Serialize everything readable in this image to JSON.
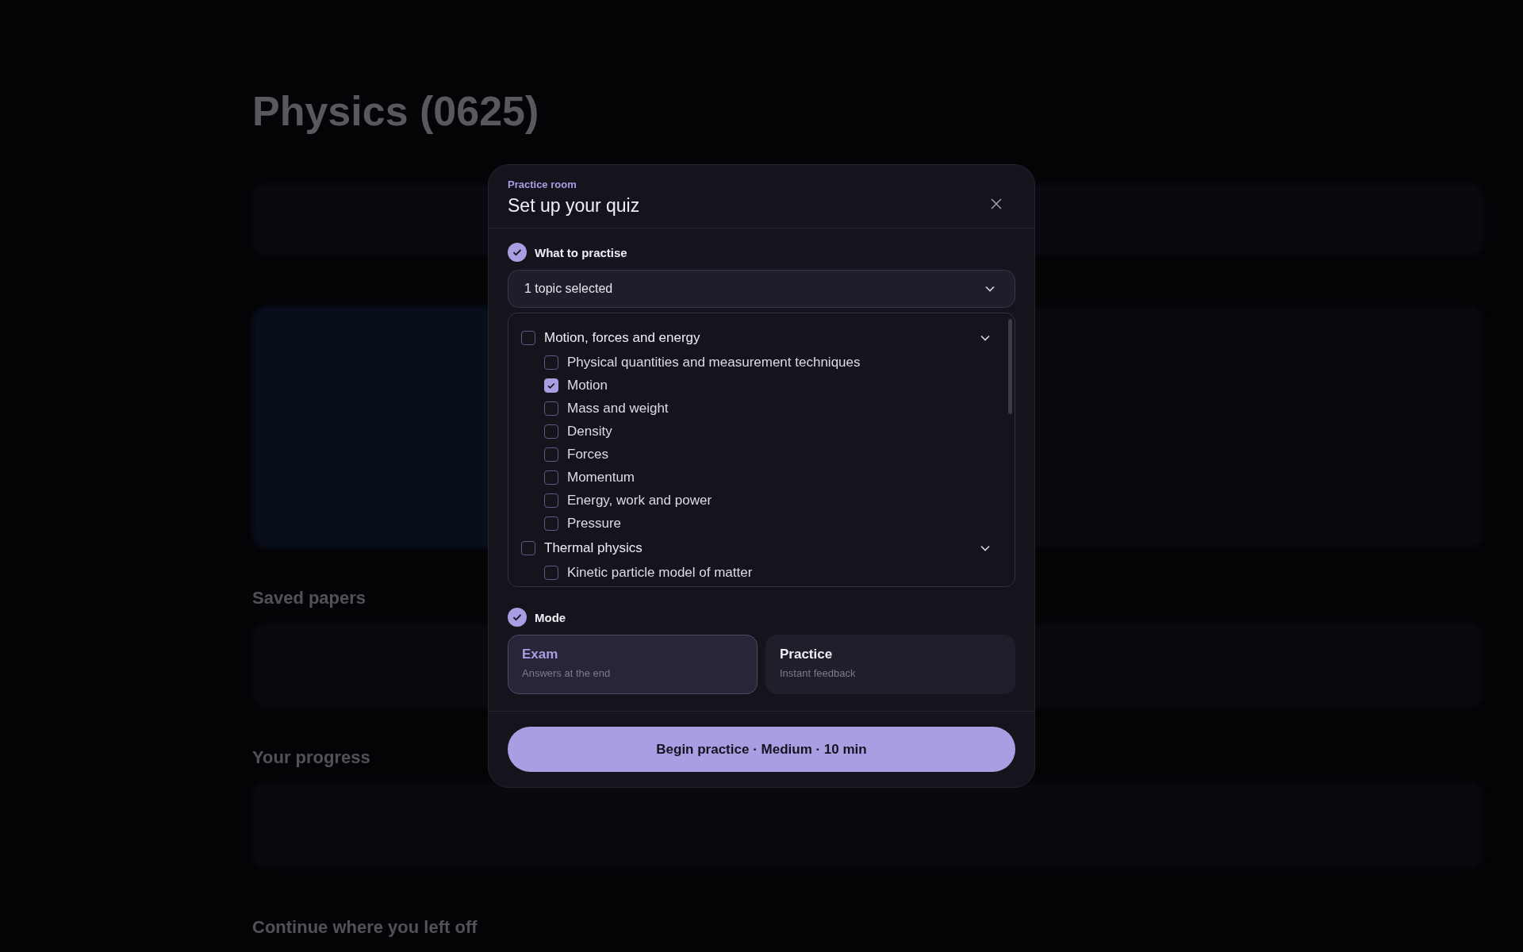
{
  "backdrop": {
    "title": "Physics (0625)",
    "sections": [
      "Saved papers",
      "Your progress",
      "Continue where you left off"
    ]
  },
  "dialog": {
    "eyebrow": "Practice room",
    "title": "Set up your quiz",
    "topics_step": {
      "label": "What to practise",
      "done": true,
      "dropdown": {
        "value": "1 topic selected"
      },
      "groups": [
        {
          "label": "Motion, forces and energy",
          "checked": false,
          "expanded": true,
          "children": [
            {
              "label": "Physical quantities and measurement techniques",
              "checked": false
            },
            {
              "label": "Motion",
              "checked": true
            },
            {
              "label": "Mass and weight",
              "checked": false
            },
            {
              "label": "Density",
              "checked": false
            },
            {
              "label": "Forces",
              "checked": false
            },
            {
              "label": "Momentum",
              "checked": false
            },
            {
              "label": "Energy, work and power",
              "checked": false
            },
            {
              "label": "Pressure",
              "checked": false
            }
          ]
        },
        {
          "label": "Thermal physics",
          "checked": false,
          "expanded": true,
          "children": [
            {
              "label": "Kinetic particle model of matter",
              "checked": false
            }
          ]
        }
      ]
    },
    "mode_step": {
      "label": "Mode",
      "done": true,
      "options": [
        {
          "title": "Exam",
          "subtitle": "Answers at the end",
          "selected": true
        },
        {
          "title": "Practice",
          "subtitle": "Instant feedback",
          "selected": false
        }
      ]
    },
    "start_button": "Begin practice · Medium · 10 min"
  }
}
